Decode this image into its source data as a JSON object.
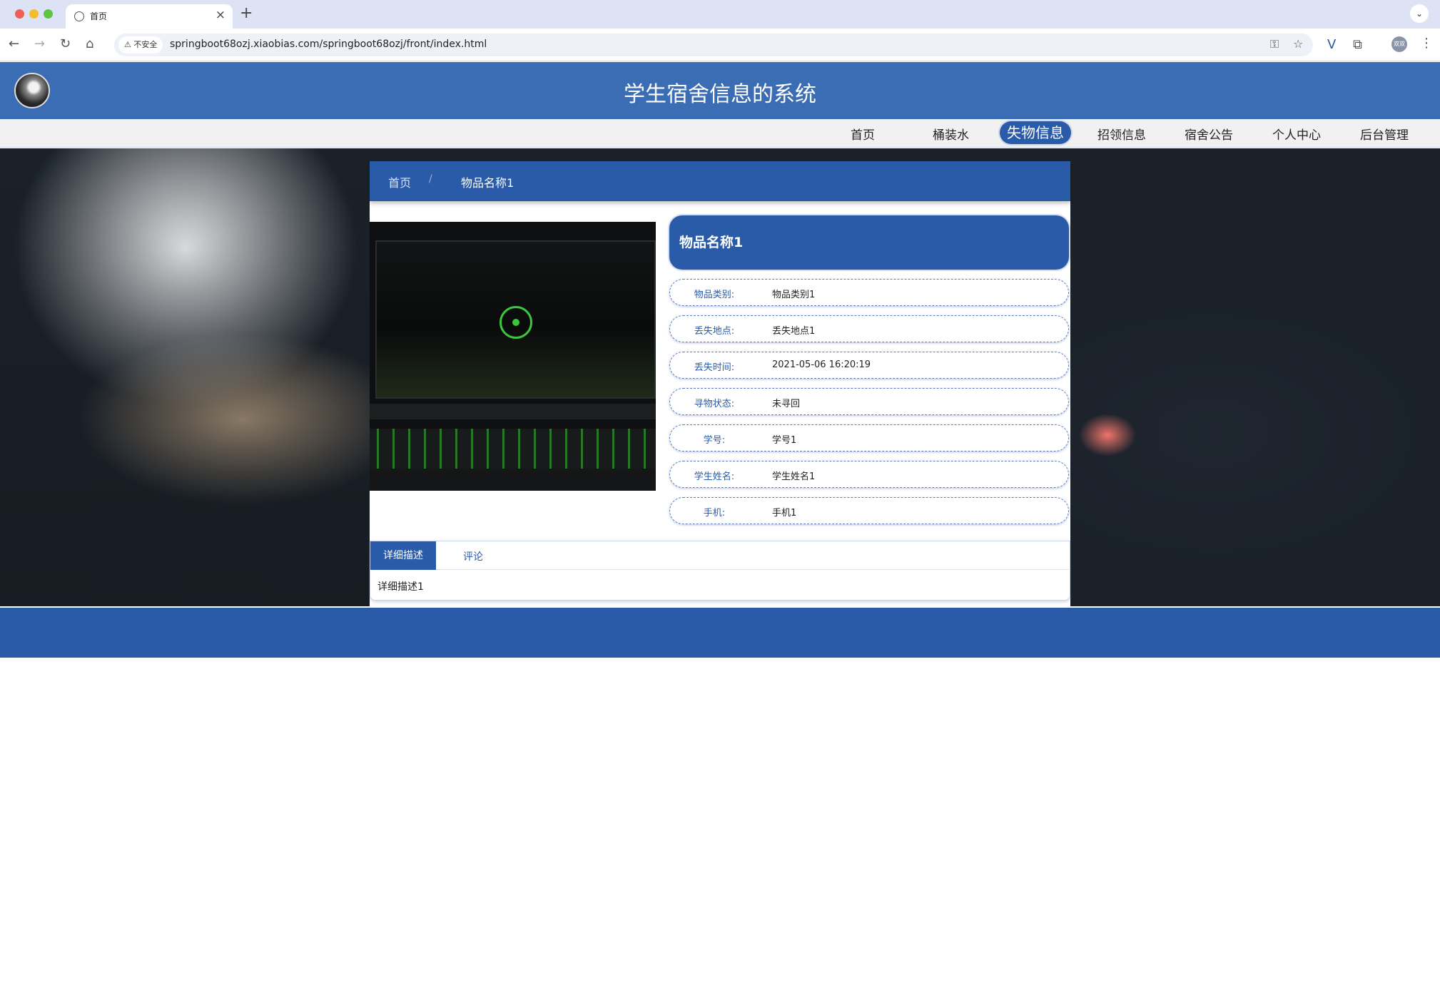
{
  "browser": {
    "tab_title": "首页",
    "insecure_label": "不安全",
    "url": "springboot68ozj.xiaobias.com/springboot68ozj/front/index.html",
    "profile_label": "双双"
  },
  "site": {
    "title": "学生宿舍信息的系统",
    "nav": [
      {
        "label": "首页"
      },
      {
        "label": "桶装水"
      },
      {
        "label": "失物信息"
      },
      {
        "label": "招领信息"
      },
      {
        "label": "宿舍公告"
      },
      {
        "label": "个人中心"
      },
      {
        "label": "后台管理"
      }
    ],
    "active_nav": "失物信息"
  },
  "breadcrumb": {
    "home": "首页",
    "separator": "/",
    "current": "物品名称1"
  },
  "item": {
    "title": "物品名称1",
    "fields": [
      {
        "label": "物品类别:",
        "value": "物品类别1"
      },
      {
        "label": "丢失地点:",
        "value": "丢失地点1"
      },
      {
        "label": "丢失时间:",
        "value": "2021-05-06 16:20:19"
      },
      {
        "label": "寻物状态:",
        "value": "未寻回"
      },
      {
        "label": "学号:",
        "value": "学号1"
      },
      {
        "label": "学生姓名:",
        "value": "学生姓名1"
      },
      {
        "label": "手机:",
        "value": "手机1"
      }
    ]
  },
  "tabs": {
    "detail_label": "详细描述",
    "comment_label": "评论",
    "detail_content": "详细描述1"
  },
  "colors": {
    "primary": "#2a5ba8",
    "header": "#3b6db5",
    "nav_bg": "#f1f1f1"
  },
  "icons": {
    "back": "arrow-left-icon",
    "forward": "arrow-right-icon",
    "reload": "reload-icon",
    "home": "home-icon",
    "key": "key-icon",
    "bookmark": "star-icon",
    "extension": "puzzle-icon",
    "menu": "kebab-menu-icon"
  }
}
